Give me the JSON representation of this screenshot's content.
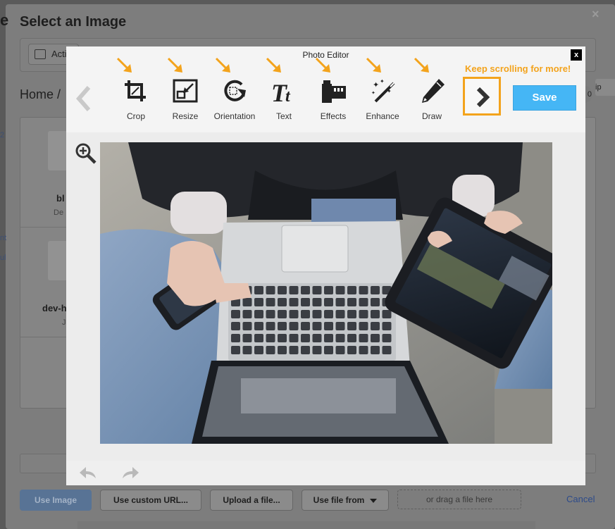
{
  "background": {
    "dialog_title": "Select an Image",
    "title_edge": "e",
    "close_glyph": "×",
    "account_label": "Acti",
    "breadcrumb": "Home /",
    "left_edge_links": [
      "2",
      "nt",
      "ul"
    ],
    "folders": [
      {
        "name": "bl",
        "sub": "De"
      },
      {
        "name": "dev-h",
        "sub": "J"
      }
    ],
    "right_edge_chips": [
      "ip",
      "0"
    ],
    "buttons": {
      "use_image": "Use Image",
      "custom_url": "Use custom URL...",
      "upload": "Upload a file...",
      "file_from": "Use file from"
    },
    "drop_zone": "or drag a file here",
    "cancel": "Cancel"
  },
  "editor": {
    "title": "Photo Editor",
    "close_label": "x",
    "tools": [
      {
        "label": "Crop",
        "icon": "crop-icon"
      },
      {
        "label": "Resize",
        "icon": "resize-icon"
      },
      {
        "label": "Orientation",
        "icon": "orientation-icon"
      },
      {
        "label": "Text",
        "icon": "text-icon"
      },
      {
        "label": "Effects",
        "icon": "effects-icon"
      },
      {
        "label": "Enhance",
        "icon": "enhance-icon"
      },
      {
        "label": "Draw",
        "icon": "draw-icon"
      }
    ],
    "hint": "Keep scrolling for more!",
    "save_label": "Save",
    "accent_color": "#f3a31c",
    "save_color": "#45b6f5"
  }
}
